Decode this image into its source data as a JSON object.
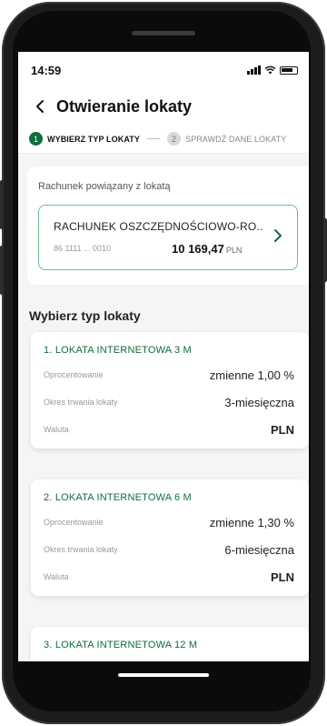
{
  "status_bar": {
    "time": "14:59"
  },
  "header": {
    "title": "Otwieranie lokaty"
  },
  "steps": [
    {
      "number": "1",
      "label": "WYBIERZ TYP LOKATY"
    },
    {
      "number": "2",
      "label": "SPRAWDŹ DANE LOKATY"
    }
  ],
  "account": {
    "caption": "Rachunek powiązany z lokatą",
    "name": "RACHUNEK OSZCZĘDNOŚCIOWO-RO..",
    "number": "86 1111 ... 0010",
    "balance": "10 169,47",
    "currency": "PLN"
  },
  "section_title": "Wybierz typ lokaty",
  "deposits": [
    {
      "title": "1. LOKATA INTERNETOWA 3 M",
      "rows": [
        {
          "label": "Oprocentowanie",
          "value": "zmienne 1,00 %"
        },
        {
          "label": "Okres trwania lokaty",
          "value": "3-miesięczna"
        },
        {
          "label": "Waluta",
          "value": "PLN"
        }
      ]
    },
    {
      "title": "2. LOKATA INTERNETOWA 6 M",
      "rows": [
        {
          "label": "Oprocentowanie",
          "value": "zmienne 1,30 %"
        },
        {
          "label": "Okres trwania lokaty",
          "value": "6-miesięczna"
        },
        {
          "label": "Waluta",
          "value": "PLN"
        }
      ]
    },
    {
      "title": "3. LOKATA INTERNETOWA 12 M"
    }
  ],
  "colors": {
    "accent": "#0f6e3b",
    "card_border": "#6fbf8f"
  }
}
